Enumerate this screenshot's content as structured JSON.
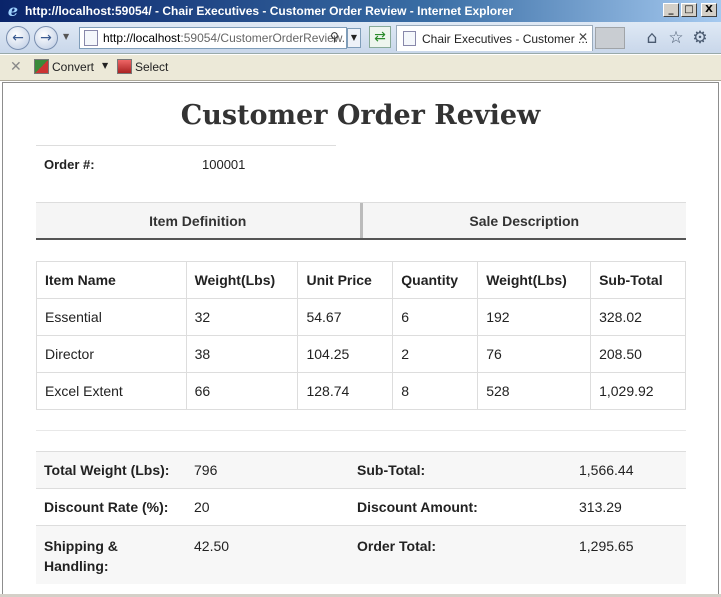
{
  "window": {
    "title": "http://localhost:59054/ - Chair Executives - Customer Order Review - Internet Explorer",
    "controls": [
      "_",
      "□",
      "X"
    ]
  },
  "nav": {
    "address_host": "http://localhost",
    "address_rest": ":59054/CustomerOrderReview.",
    "tab_title": "Chair Executives - Customer ..."
  },
  "commandbar": {
    "convert_label": "Convert",
    "select_label": "Select"
  },
  "page": {
    "title": "Customer Order Review",
    "order_label": "Order #:",
    "order_number": "100001",
    "tabs": [
      "Item Definition",
      "Sale Description"
    ],
    "table": {
      "headers": [
        "Item Name",
        "Weight(Lbs)",
        "Unit Price",
        "Quantity",
        "Weight(Lbs)",
        "Sub-Total"
      ],
      "rows": [
        [
          "Essential",
          "32",
          "54.67",
          "6",
          "192",
          "328.02"
        ],
        [
          "Director",
          "38",
          "104.25",
          "2",
          "76",
          "208.50"
        ],
        [
          "Excel Extent",
          "66",
          "128.74",
          "8",
          "528",
          "1,029.92"
        ]
      ]
    },
    "summary": {
      "total_weight_label": "Total Weight (Lbs):",
      "total_weight": "796",
      "subtotal_label": "Sub-Total:",
      "subtotal": "1,566.44",
      "discount_rate_label": "Discount Rate (%):",
      "discount_rate": "20",
      "discount_amount_label": "Discount Amount:",
      "discount_amount": "313.29",
      "shipping_label": "Shipping & Handling:",
      "shipping": "42.50",
      "order_total_label": "Order Total:",
      "order_total": "1,295.65"
    }
  }
}
